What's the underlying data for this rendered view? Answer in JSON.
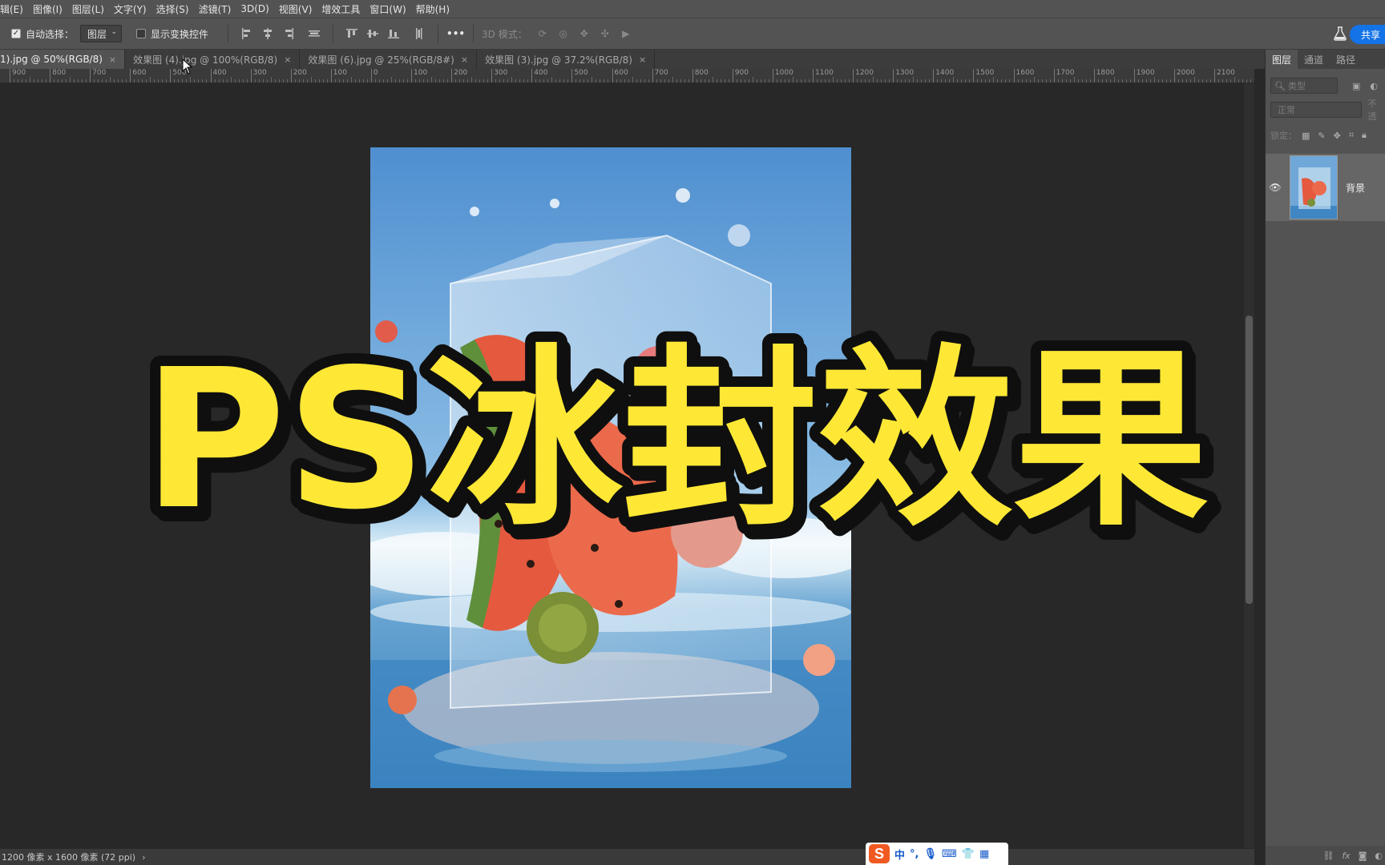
{
  "menu": [
    "辑(E)",
    "图像(I)",
    "图层(L)",
    "文字(Y)",
    "选择(S)",
    "滤镜(T)",
    "3D(D)",
    "视图(V)",
    "增效工具",
    "窗口(W)",
    "帮助(H)"
  ],
  "options": {
    "auto_select_label": "自动选择：",
    "auto_select_checked": true,
    "auto_select_target": "图层",
    "show_transform_label": "显示变换控件",
    "show_transform_checked": false,
    "mode_3d_label": "3D 模式：",
    "more_label": "•••",
    "share_label": "共享"
  },
  "tabs": [
    {
      "label": "1).jpg @ 50%(RGB/8)",
      "active": true
    },
    {
      "label": "效果图 (4).jpg @ 100%(RGB/8)",
      "active": false
    },
    {
      "label": "效果图 (6).jpg @ 25%(RGB/8#)",
      "active": false
    },
    {
      "label": "效果图 (3).jpg @ 37.2%(RGB/8)",
      "active": false
    }
  ],
  "tab_close_glyph": "×",
  "ruler_labels": [
    "900",
    "800",
    "700",
    "600",
    "500",
    "400",
    "300",
    "200",
    "100",
    "0",
    "100",
    "200",
    "300",
    "400",
    "500",
    "600",
    "700",
    "800",
    "900",
    "1000",
    "1100",
    "1200",
    "1300",
    "1400",
    "1500",
    "1600",
    "1700",
    "1800",
    "1900",
    "2000",
    "2100"
  ],
  "overlay": {
    "title": "PS冰封效果",
    "fill_color": "#ffe835",
    "stroke_color": "#0f0f0f"
  },
  "status": {
    "doc_info": "1200 像素 x 1600 像素 (72 ppi)",
    "arrow": "›"
  },
  "ime": {
    "logo": "S",
    "lang": "中",
    "punct": "°,"
  },
  "layers_panel": {
    "tabs": [
      "图层",
      "通道",
      "路径"
    ],
    "filter_placeholder": "类型",
    "blend_mode": "正常",
    "opacity_label": "不透",
    "lock_label": "锁定：",
    "layers": [
      {
        "name": "背景",
        "visible": true
      }
    ],
    "bottom_icons": [
      "link-icon",
      "fx-icon",
      "mask-icon",
      "adjustment-icon"
    ],
    "fx_label": "fx"
  },
  "colors": {
    "ui_dark": "#282828",
    "ui_panel": "#535353",
    "accent_blue": "#1473e6"
  }
}
